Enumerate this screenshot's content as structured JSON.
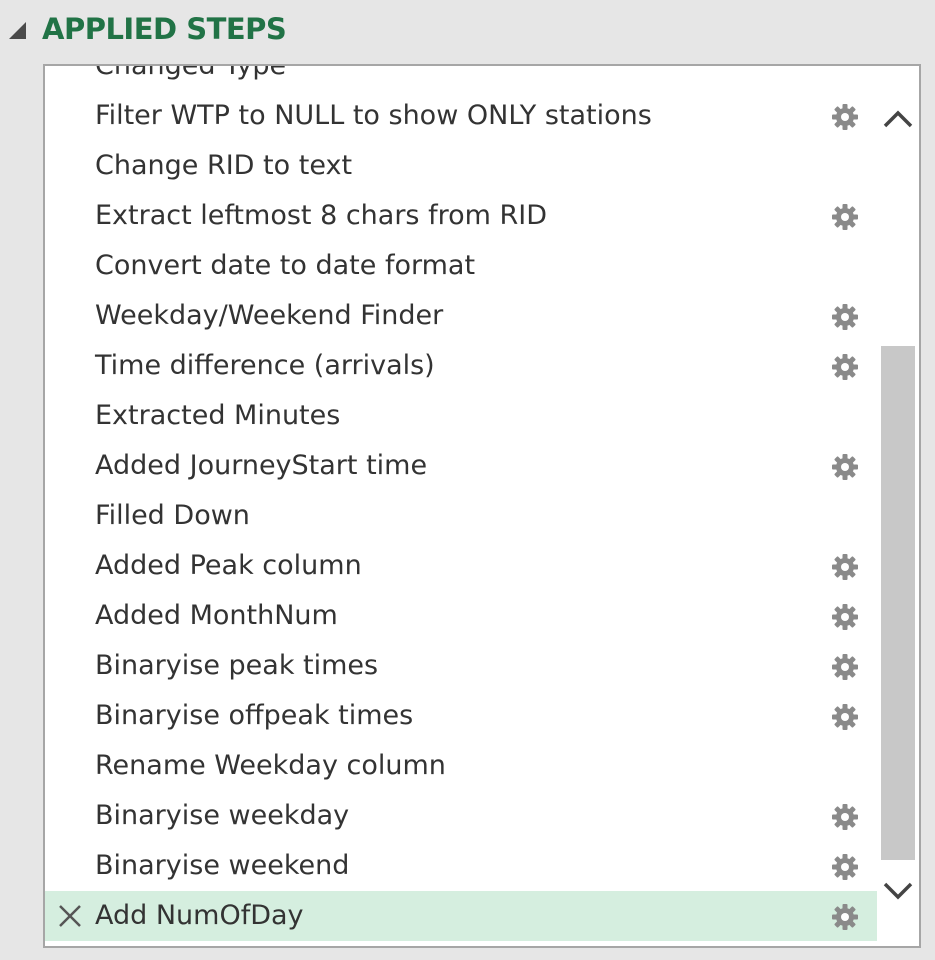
{
  "header": {
    "title": "APPLIED STEPS"
  },
  "steps": [
    {
      "label": "Changed Type",
      "has_settings": false,
      "selected": false
    },
    {
      "label": "Filter WTP to NULL to show ONLY stations",
      "has_settings": true,
      "selected": false
    },
    {
      "label": "Change RID to text",
      "has_settings": false,
      "selected": false
    },
    {
      "label": "Extract leftmost 8 chars from RID",
      "has_settings": true,
      "selected": false
    },
    {
      "label": "Convert date to date format",
      "has_settings": false,
      "selected": false
    },
    {
      "label": "Weekday/Weekend Finder",
      "has_settings": true,
      "selected": false
    },
    {
      "label": "Time difference (arrivals)",
      "has_settings": true,
      "selected": false
    },
    {
      "label": "Extracted Minutes",
      "has_settings": false,
      "selected": false
    },
    {
      "label": "Added JourneyStart time",
      "has_settings": true,
      "selected": false
    },
    {
      "label": "Filled Down",
      "has_settings": false,
      "selected": false
    },
    {
      "label": "Added Peak column",
      "has_settings": true,
      "selected": false
    },
    {
      "label": "Added MonthNum",
      "has_settings": true,
      "selected": false
    },
    {
      "label": "Binaryise peak times",
      "has_settings": true,
      "selected": false
    },
    {
      "label": "Binaryise offpeak times",
      "has_settings": true,
      "selected": false
    },
    {
      "label": "Rename Weekday column",
      "has_settings": false,
      "selected": false
    },
    {
      "label": "Binaryise weekday",
      "has_settings": true,
      "selected": false
    },
    {
      "label": "Binaryise weekend",
      "has_settings": true,
      "selected": false
    },
    {
      "label": "Add NumOfDay",
      "has_settings": true,
      "selected": true
    }
  ],
  "colors": {
    "header": "#217346",
    "selected_row": "#d5eedf",
    "text": "#333333",
    "icon": "#8a8a8a"
  },
  "icons": {
    "collapse": "collapse-triangle-icon",
    "settings": "gear-icon",
    "delete": "delete-x-icon",
    "scroll_up": "chevron-up-icon",
    "scroll_down": "chevron-down-icon"
  }
}
